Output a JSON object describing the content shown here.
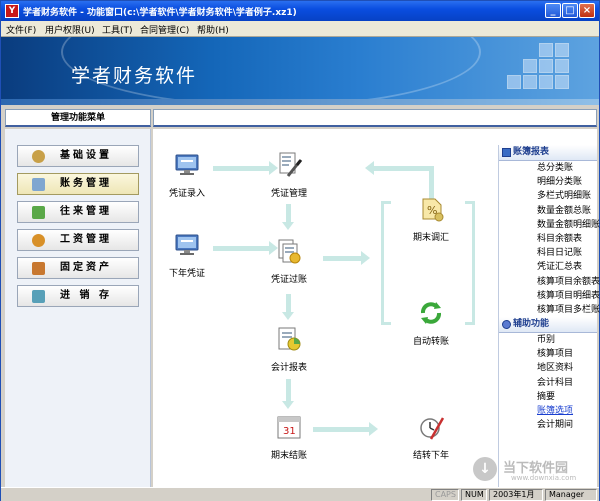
{
  "window": {
    "app_icon": "Y",
    "title": "学者财务软件 - 功能窗口(c:\\学者软件\\学者财务软件\\学者例子.xz1)",
    "minimize": "_",
    "maximize": "□",
    "close": "×"
  },
  "menu": [
    {
      "label": "文件(F)"
    },
    {
      "label": "用户权限(U)"
    },
    {
      "label": "工具(T)"
    },
    {
      "label": "合同管理(C)"
    },
    {
      "label": "帮助(H)"
    }
  ],
  "banner": {
    "title": "学者财务软件"
  },
  "left_panel": {
    "header": "管理功能菜单",
    "modules": [
      {
        "label": "基础设置",
        "icon": "gear-icon",
        "color": "#c8a048",
        "active": false
      },
      {
        "label": "账务管理",
        "icon": "ledger-icon",
        "color": "#7fa6d0",
        "active": true
      },
      {
        "label": "往来管理",
        "icon": "exchange-icon",
        "color": "#5aa848",
        "active": false
      },
      {
        "label": "工资管理",
        "icon": "people-icon",
        "color": "#d89028",
        "active": false
      },
      {
        "label": "固定资产",
        "icon": "house-icon",
        "color": "#c87830",
        "active": false
      },
      {
        "label": "进 销 存",
        "icon": "cart-icon",
        "color": "#58a0b8",
        "active": false
      }
    ]
  },
  "flow": {
    "nodes": [
      {
        "label": "凭证录入",
        "icon": "computer-icon"
      },
      {
        "label": "凭证管理",
        "icon": "document-edit-icon"
      },
      {
        "label": "下年凭证",
        "icon": "computer-icon"
      },
      {
        "label": "凭证过账",
        "icon": "document-stack-icon"
      },
      {
        "label": "期末调汇",
        "icon": "exchange-rate-icon"
      },
      {
        "label": "自动转账",
        "icon": "recycle-icon"
      },
      {
        "label": "会计报表",
        "icon": "report-chart-icon"
      },
      {
        "label": "期末结账",
        "icon": "calendar-icon",
        "day": "31"
      },
      {
        "label": "结转下年",
        "icon": "clock-pen-icon"
      }
    ]
  },
  "right_panel": {
    "sections": [
      {
        "title": "账簿报表",
        "items": [
          "总分类账",
          "明细分类账",
          "多栏式明细账",
          "数量金额总账",
          "数量金额明细账",
          "科目余额表",
          "科目日记账",
          "凭证汇总表",
          "核算项目余额表",
          "核算项目明细表",
          "核算项目多栏账"
        ]
      },
      {
        "title": "辅助功能",
        "items": [
          "币别",
          "核算项目",
          "地区资料",
          "会计科目",
          "摘要",
          "账簿选项",
          "会计期间"
        ]
      }
    ]
  },
  "statusbar": {
    "caps": "CAPS",
    "num": "NUM",
    "period": "2003年1月",
    "user": "Manager"
  },
  "watermark": {
    "title": "当下软件园",
    "url": "www.downxia.com"
  }
}
